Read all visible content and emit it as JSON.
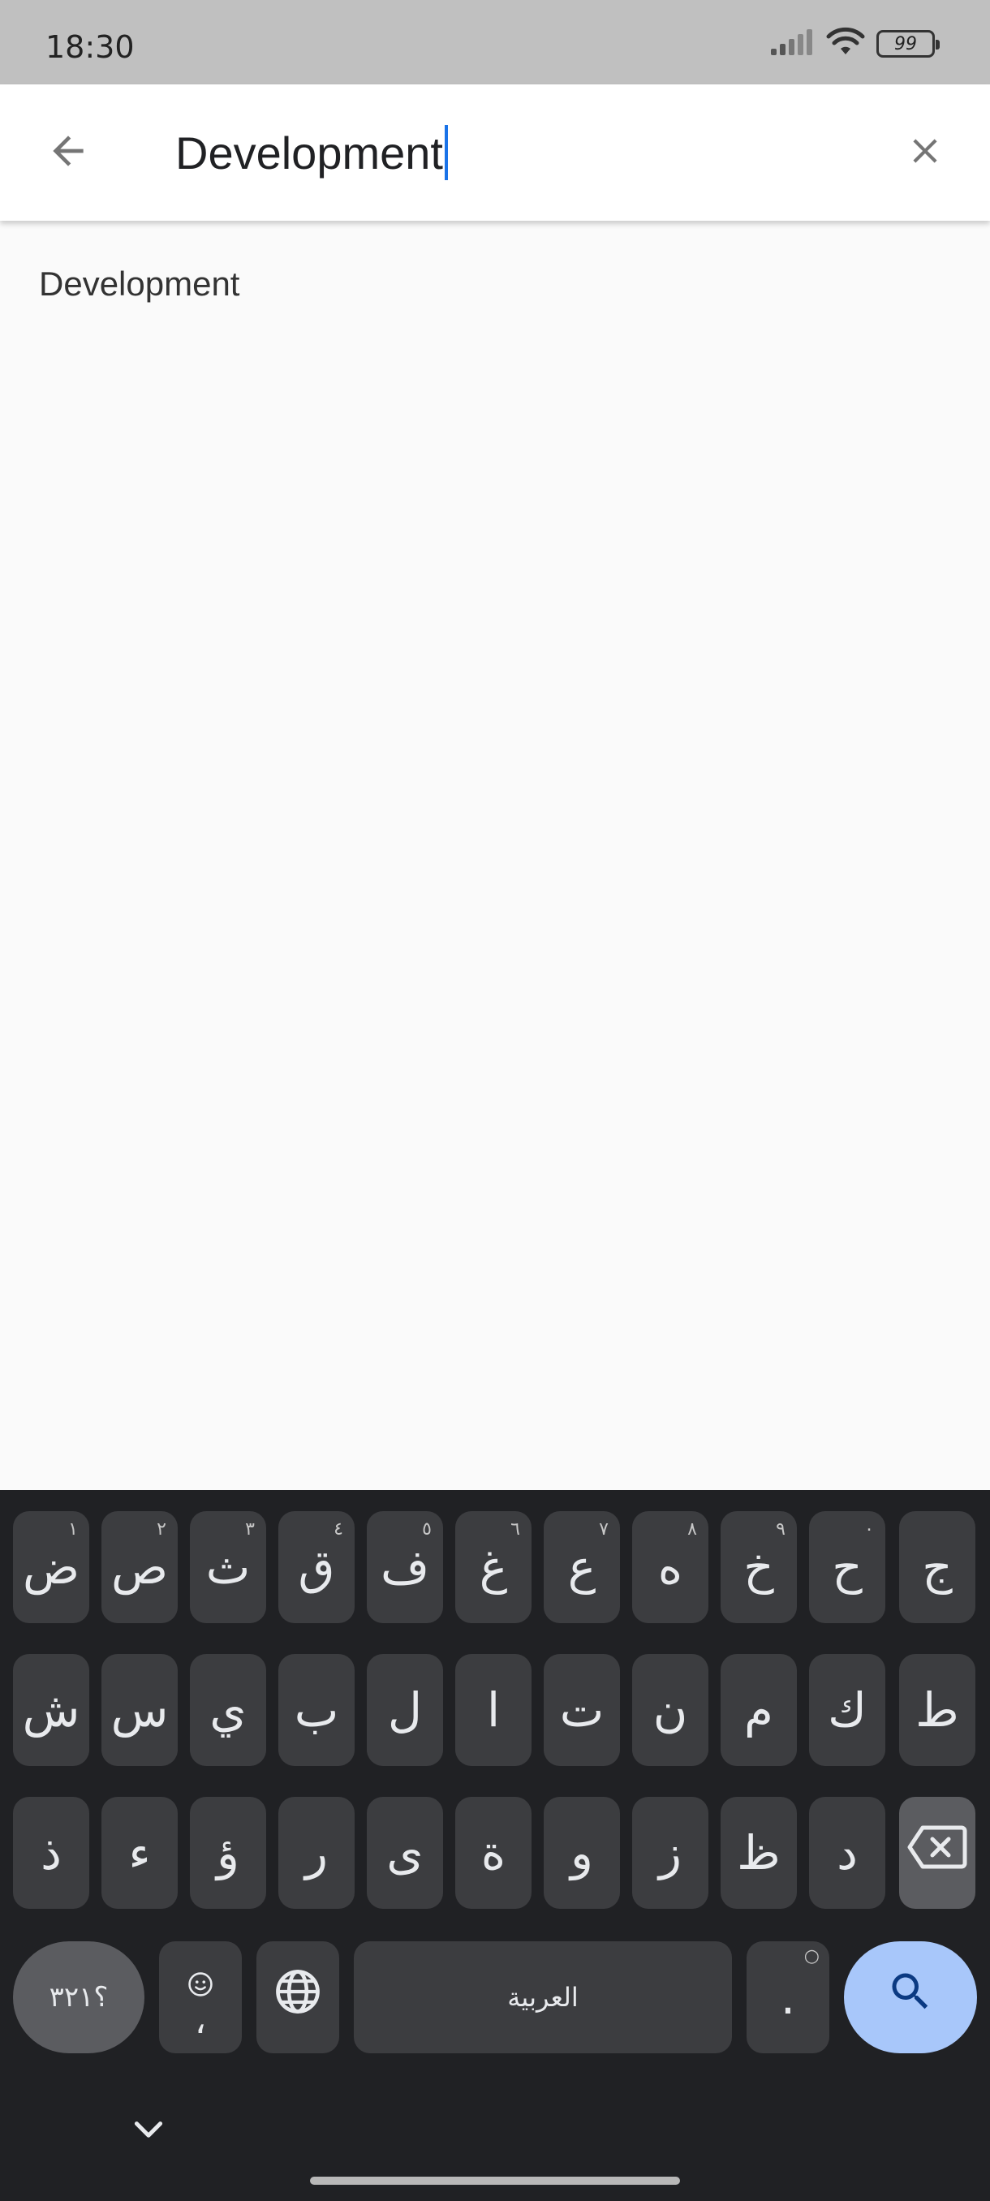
{
  "status": {
    "time": "18:30",
    "battery": "99",
    "icons": [
      "signal-icon",
      "wifi-icon",
      "battery-icon"
    ]
  },
  "search": {
    "value": "Development",
    "back_icon": "arrow-left-icon",
    "clear_icon": "close-icon"
  },
  "results": [
    "Development"
  ],
  "keyboard": {
    "row1": [
      {
        "label": "ض",
        "sup": "١"
      },
      {
        "label": "ص",
        "sup": "٢"
      },
      {
        "label": "ث",
        "sup": "٣"
      },
      {
        "label": "ق",
        "sup": "٤"
      },
      {
        "label": "ف",
        "sup": "٥"
      },
      {
        "label": "غ",
        "sup": "٦"
      },
      {
        "label": "ع",
        "sup": "٧"
      },
      {
        "label": "ه",
        "sup": "٨"
      },
      {
        "label": "خ",
        "sup": "٩"
      },
      {
        "label": "ح",
        "sup": "٠"
      },
      {
        "label": "ج",
        "sup": ""
      }
    ],
    "row2": [
      "ش",
      "س",
      "ي",
      "ب",
      "ل",
      "ا",
      "ت",
      "ن",
      "م",
      "ك",
      "ط"
    ],
    "row3": [
      "ذ",
      "ء",
      "ؤ",
      "ر",
      "ى",
      "ة",
      "و",
      "ز",
      "ظ",
      "د"
    ],
    "symbols_label": "؟٣٢١",
    "comma_label": "،",
    "space_label": "العربية",
    "period_label": ".",
    "colors": {
      "background": "#202124",
      "key": "#3c3d40",
      "action": "#a8c7fa"
    }
  }
}
